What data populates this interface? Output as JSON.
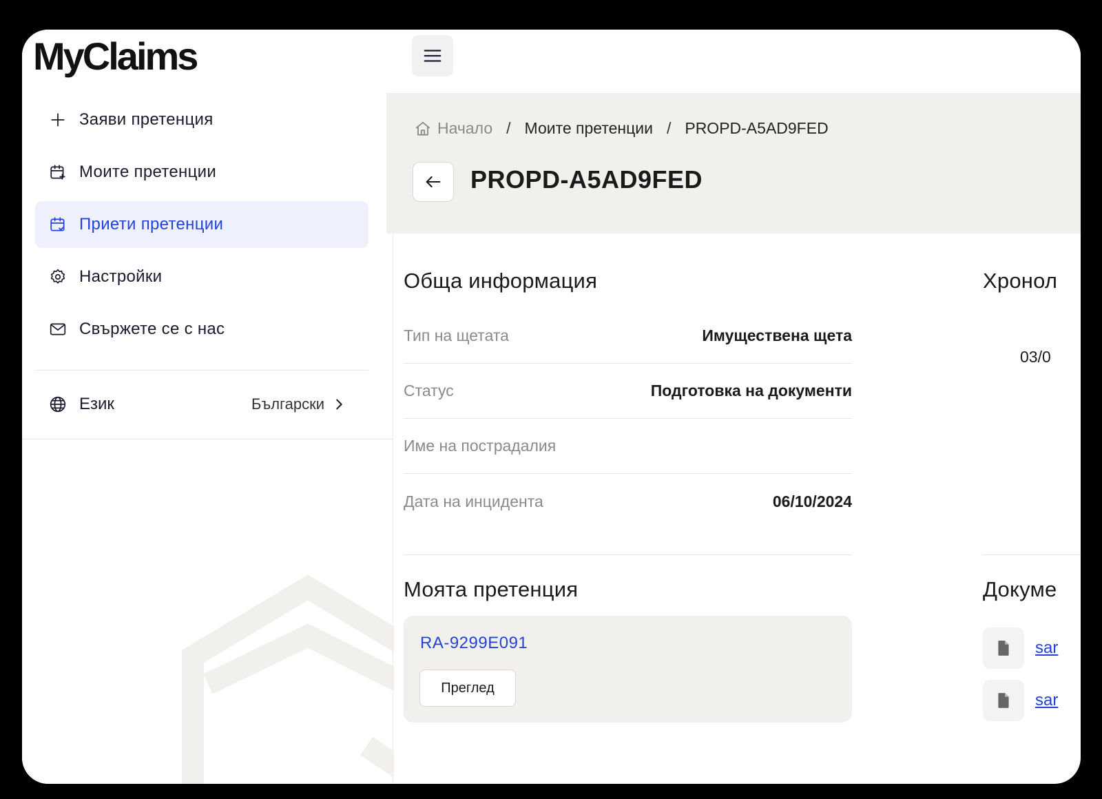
{
  "app": {
    "logo_text": "MyClaims"
  },
  "sidebar": {
    "items": [
      {
        "label": "Заяви претенция",
        "icon": "plus-icon"
      },
      {
        "label": "Моите претенции",
        "icon": "calendar-plus-icon"
      },
      {
        "label": "Приети претенции",
        "icon": "calendar-check-icon",
        "active": true
      },
      {
        "label": "Настройки",
        "icon": "gear-icon"
      },
      {
        "label": "Свържете се с нас",
        "icon": "mail-icon"
      }
    ],
    "language": {
      "label": "Език",
      "value": "Български"
    }
  },
  "breadcrumb": {
    "home": "Начало",
    "parent": "Моите претенции",
    "current": "PROPD-A5AD9FED"
  },
  "page": {
    "title": "PROPD-A5AD9FED"
  },
  "general_info": {
    "title": "Обща информация",
    "rows": [
      {
        "label": "Тип на щетата",
        "value": "Имуществена щета"
      },
      {
        "label": "Статус",
        "value": "Подготовка на документи"
      },
      {
        "label": "Име на пострадалия",
        "value": ""
      },
      {
        "label": "Дата на инцидента",
        "value": "06/10/2024"
      }
    ]
  },
  "my_claim": {
    "title": "Моята претенция",
    "claim_id": "RA-9299E091",
    "view_label": "Преглед"
  },
  "timeline": {
    "title": "Хронол",
    "date": "03/0"
  },
  "documents": {
    "title": "Докуме",
    "items": [
      "sar",
      "sar"
    ]
  },
  "colors": {
    "accent": "#2243d9",
    "active_bg": "#eef1fd",
    "band_bg": "#f1f0ed"
  }
}
